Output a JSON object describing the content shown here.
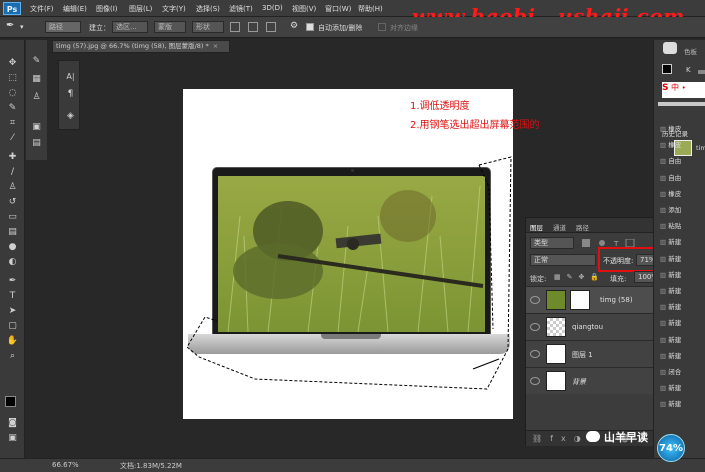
{
  "menubar": {
    "logo": "Ps",
    "items": [
      "文件(F)",
      "编辑(E)",
      "图像(I)",
      "图层(L)",
      "文字(Y)",
      "选择(S)",
      "滤镜(T)",
      "3D(D)",
      "视图(V)",
      "窗口(W)",
      "帮助(H)"
    ]
  },
  "watermark": "www.haobi...ushaji.com",
  "options": {
    "mode_value": "路径",
    "build_label": "建立：",
    "selection_btn": "选区...",
    "mask_btn": "蒙版",
    "shape_btn": "形状",
    "auto_add_label": "自动添加/删除",
    "auto_add_checked": true,
    "align_edges_label": "对齐边缘"
  },
  "document": {
    "tab_title": "timg (57).jpg @ 66.7% (timg (58), 图层蒙版/8) *",
    "close": "×"
  },
  "annotations": {
    "line1": "1.调低透明度",
    "line2": "2.用钢笔选出超出屏幕范围的"
  },
  "layers_panel": {
    "tabs": [
      "图层",
      "通道",
      "路径"
    ],
    "filter_kind": "类型",
    "blend_mode": "正常",
    "opacity_label": "不透明度:",
    "opacity_value": "71%",
    "lock_label": "锁定:",
    "fill_label": "填充:",
    "fill_value": "100%",
    "layers": [
      {
        "name": "timg (58)",
        "visible": true
      },
      {
        "name": "qiangtou",
        "visible": true
      },
      {
        "name": "图层 1",
        "visible": true
      },
      {
        "name": "背景",
        "visible": true
      }
    ]
  },
  "right_dock": {
    "swatch_tab": "色板",
    "k_label": "K",
    "history_title": "历史记录",
    "history_top": "tim",
    "history_items": [
      "橡皮",
      "橡皮",
      "自由",
      "自由",
      "橡皮",
      "添加",
      "粘贴",
      "新建",
      "新建",
      "新建",
      "新建",
      "新建",
      "新建",
      "新建",
      "新建",
      "闭合",
      "新建",
      "新建"
    ]
  },
  "status": {
    "zoom": "66.67%",
    "doc_info": "文档:1.83M/5.22M"
  },
  "overlay": {
    "wechat_name": "山羊早读",
    "badge": "74%"
  },
  "colors": {
    "annotation_red": "#e01010",
    "highlight_box": "#e01010",
    "watermark_red": "#ff1a1a"
  }
}
